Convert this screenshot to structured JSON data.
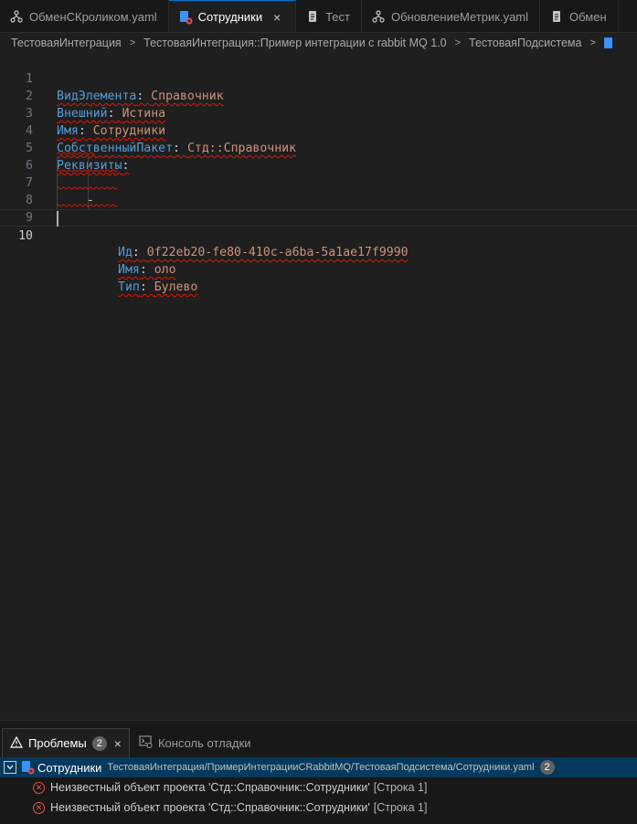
{
  "tabs": [
    {
      "label": "ОбменСКроликом.yaml",
      "icon": "git-branch-icon",
      "active": false
    },
    {
      "label": "Сотрудники",
      "icon": "catalog-error-icon",
      "active": true
    },
    {
      "label": "Тест",
      "icon": "file-icon",
      "active": false
    },
    {
      "label": "ОбновлениеМетрик.yaml",
      "icon": "git-branch-icon",
      "active": false
    },
    {
      "label": "Обмен",
      "icon": "file-icon",
      "active": false
    }
  ],
  "tab_close": "×",
  "breadcrumb": [
    "ТестоваяИнтеграция",
    "ТестоваяИнтеграция::Пример интеграции с rabbit MQ 1.0",
    "ТестоваяПодсистема"
  ],
  "breadcrumb_sep": ">",
  "editor": {
    "lines": [
      {
        "n": "1",
        "key": "ВидЭлемента",
        "sep": ": ",
        "value": "Справочник"
      },
      {
        "n": "2",
        "key": "Внешний",
        "sep": ": ",
        "value": "Истина"
      },
      {
        "n": "3",
        "key": "Имя",
        "sep": ": ",
        "value": "Сотрудники"
      },
      {
        "n": "4",
        "key": "СобственныйПакет",
        "sep": ": ",
        "value": "Стд::Справочник"
      },
      {
        "n": "5",
        "key": "Реквизиты",
        "sep": ":",
        "value": ""
      },
      {
        "n": "6",
        "dash": "-"
      },
      {
        "n": "7",
        "key": "Ид",
        "sep": ": ",
        "value": "0f22eb20-fe80-410c-a6ba-5a1ae17f9990"
      },
      {
        "n": "8",
        "key": "Имя",
        "sep": ": ",
        "value": "оло"
      },
      {
        "n": "9",
        "key": "Тип",
        "sep": ": ",
        "value": "Булево"
      },
      {
        "n": "10"
      }
    ]
  },
  "panel": {
    "tabs": [
      {
        "label": "Проблемы",
        "badge": "2",
        "icon": "warning-icon",
        "active": true
      },
      {
        "label": "Консоль отладки",
        "icon": "debug-console-icon",
        "active": false
      }
    ],
    "file": {
      "name": "Сотрудники",
      "path": "ТестоваяИнтеграция/ПримерИнтеграцииCRabbitMQ/ТестоваяПодсистема/Сотрудники.yaml",
      "count": "2"
    },
    "problems": [
      {
        "message": "Неизвестный объект проекта 'Стд::Справочник::Сотрудники'",
        "location": "[Строка 1]"
      },
      {
        "message": "Неизвестный объект проекта 'Стд::Справочник::Сотрудники'",
        "location": "[Строка 1]"
      }
    ]
  },
  "colors": {
    "key": "#569cd6",
    "value": "#ce9178",
    "error": "#f14c4c",
    "selection": "#04395e"
  }
}
